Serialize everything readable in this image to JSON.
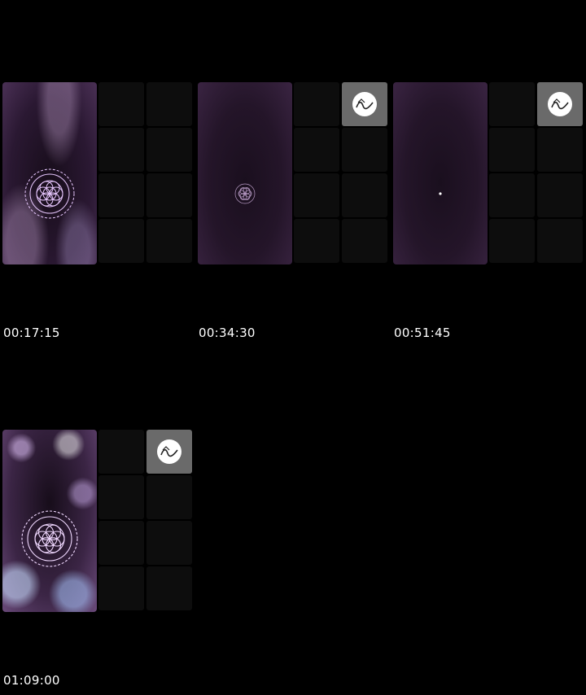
{
  "frames": [
    {
      "timestamp": "00:17:15",
      "preview": "soft",
      "mandala": "large",
      "badge": false
    },
    {
      "timestamp": "00:34:30",
      "preview": "dim",
      "mandala": "small",
      "badge": true
    },
    {
      "timestamp": "00:51:45",
      "preview": "dim",
      "mandala": "dot",
      "badge": true
    },
    {
      "timestamp": "01:09:00",
      "preview": "bright",
      "mandala": "large",
      "badge": true
    }
  ],
  "icons": {
    "badge": "channel-logo-icon",
    "pattern": "mandala-icon"
  },
  "colors": {
    "background": "#000000",
    "tile": "#0d0d0d",
    "badge_tile": "#6a6a6a",
    "mandala": "#e8c8ff"
  }
}
